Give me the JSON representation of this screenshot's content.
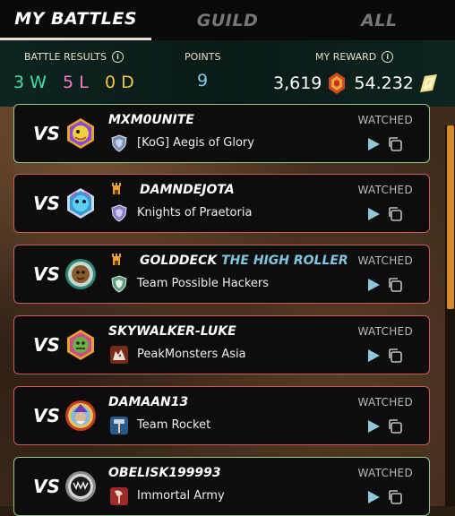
{
  "tabs": [
    {
      "label": "MY BATTLES",
      "active": true
    },
    {
      "label": "GUILD",
      "active": false
    },
    {
      "label": "ALL",
      "active": false
    }
  ],
  "summary": {
    "battle_results_label": "BATTLE RESULTS",
    "wins": "3 W",
    "losses": "5 L",
    "draws": "0 D",
    "points_label": "POINTS",
    "points": "9",
    "reward_label": "MY REWARD",
    "reward_one": "3,619",
    "reward_two": "54.232",
    "info_glyph": "i"
  },
  "colors": {
    "win_border": "#8fc98a",
    "loss_border": "#c85a5a",
    "wins": "#3fe0b0",
    "losses": "#ff7ac8",
    "draws": "#f2c744",
    "points": "#7ecfe8",
    "title": "#7fc6e0"
  },
  "battles": [
    {
      "vs": "VS",
      "player": "MXM0UNITE",
      "title": "",
      "guild": "[KoG] Aegis of Glory",
      "status": "WATCHED",
      "result": "win",
      "avatar_icon": "dragon-avatar-icon",
      "guild_icon": "shield-icon",
      "rank_icon": ""
    },
    {
      "vs": "VS",
      "player": "DAMNDEJOTA",
      "title": "",
      "guild": "Knights of Praetoria",
      "status": "WATCHED",
      "result": "loss",
      "avatar_icon": "blue-creature-avatar-icon",
      "guild_icon": "shield-icon",
      "rank_icon": "tower-icon"
    },
    {
      "vs": "VS",
      "player": "GOLDDECK",
      "title": "THE HIGH ROLLER",
      "guild": "Team Possible Hackers",
      "status": "WATCHED",
      "result": "loss",
      "avatar_icon": "goblin-avatar-icon",
      "guild_icon": "shield-icon",
      "rank_icon": "tower-icon"
    },
    {
      "vs": "VS",
      "player": "SKYWALKER-LUKE",
      "title": "",
      "guild": "PeakMonsters Asia",
      "status": "WATCHED",
      "result": "loss",
      "avatar_icon": "orc-avatar-icon",
      "guild_icon": "wolf-icon",
      "rank_icon": ""
    },
    {
      "vs": "VS",
      "player": "DAMAAN13",
      "title": "",
      "guild": "Team Rocket",
      "status": "WATCHED",
      "result": "loss",
      "avatar_icon": "wizard-avatar-icon",
      "guild_icon": "hammer-icon",
      "rank_icon": ""
    },
    {
      "vs": "VS",
      "player": "OBELISK199993",
      "title": "",
      "guild": "Immortal Army",
      "status": "WATCHED",
      "result": "win",
      "avatar_icon": "monster-avatar-icon",
      "guild_icon": "axe-icon",
      "rank_icon": ""
    }
  ]
}
